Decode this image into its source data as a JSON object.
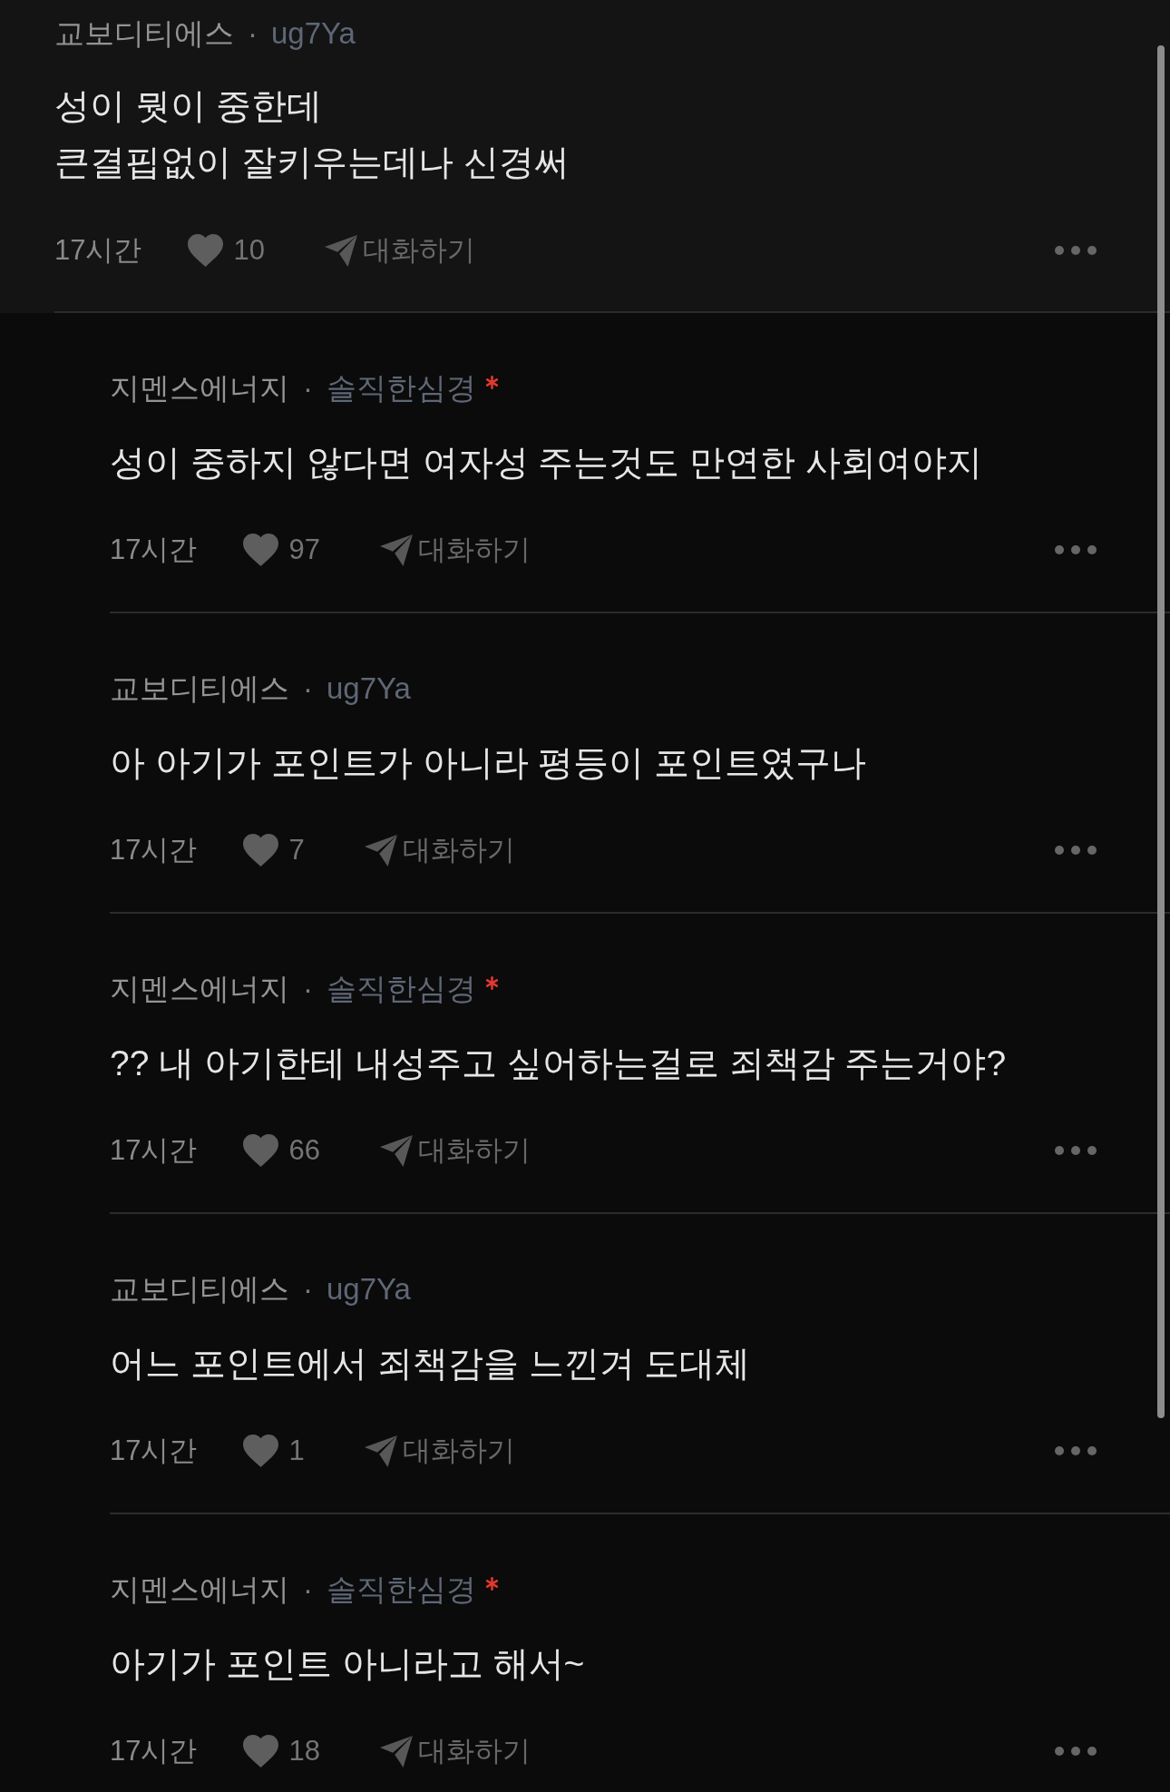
{
  "comments": [
    {
      "company": "교보디티에스",
      "separator": "·",
      "nickname": "ug7Ya",
      "is_writer": false,
      "text": "성이 뭣이 중한데\n큰결핍없이 잘키우는데나 신경써",
      "time": "17시간",
      "likes": "10",
      "talk_label": "대화하기",
      "replies": [
        {
          "company": "지멘스에너지",
          "separator": "·",
          "nickname": "솔직한심경",
          "is_writer": true,
          "text": "성이 중하지 않다면 여자성 주는것도 만연한 사회여야지",
          "time": "17시간",
          "likes": "97",
          "talk_label": "대화하기"
        },
        {
          "company": "교보디티에스",
          "separator": "·",
          "nickname": "ug7Ya",
          "is_writer": false,
          "text": "아 아기가 포인트가 아니라 평등이 포인트였구나",
          "time": "17시간",
          "likes": "7",
          "talk_label": "대화하기"
        },
        {
          "company": "지멘스에너지",
          "separator": "·",
          "nickname": "솔직한심경",
          "is_writer": true,
          "text": "?? 내 아기한테 내성주고 싶어하는걸로 죄책감 주는거야?",
          "time": "17시간",
          "likes": "66",
          "talk_label": "대화하기"
        },
        {
          "company": "교보디티에스",
          "separator": "·",
          "nickname": "ug7Ya",
          "is_writer": false,
          "text": "어느 포인트에서 죄책감을 느낀겨 도대체",
          "time": "17시간",
          "likes": "1",
          "talk_label": "대화하기"
        },
        {
          "company": "지멘스에너지",
          "separator": "·",
          "nickname": "솔직한심경",
          "is_writer": true,
          "text": "아기가 포인트 아니라고 해서~",
          "time": "17시간",
          "likes": "18",
          "talk_label": "대화하기"
        }
      ]
    }
  ]
}
